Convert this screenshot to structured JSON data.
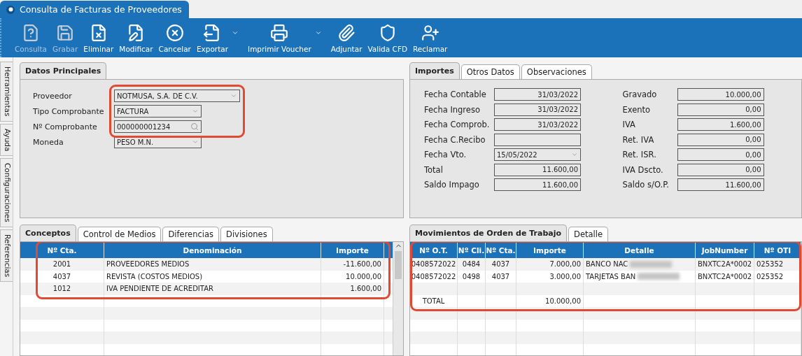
{
  "window": {
    "title": "Consulta de Facturas de Proveedores"
  },
  "toolbar": [
    {
      "label": "Consulta",
      "disabled": true,
      "dropdown": false
    },
    {
      "label": "Grabar",
      "disabled": true,
      "dropdown": false
    },
    {
      "label": "Eliminar",
      "disabled": false,
      "dropdown": false
    },
    {
      "label": "Modificar",
      "disabled": false,
      "dropdown": false
    },
    {
      "label": "Cancelar",
      "disabled": false,
      "dropdown": false
    },
    {
      "label": "Exportar",
      "disabled": false,
      "dropdown": true
    },
    {
      "label": "Imprimir Voucher",
      "disabled": false,
      "dropdown": true
    },
    {
      "label": "Adjuntar",
      "disabled": false,
      "dropdown": false
    },
    {
      "label": "Valida CFD",
      "disabled": false,
      "dropdown": false
    },
    {
      "label": "Reclamar",
      "disabled": false,
      "dropdown": false
    }
  ],
  "side_tabs": [
    {
      "label": "Herramientas"
    },
    {
      "label": "Ayuda"
    },
    {
      "label": "Configuraciones"
    },
    {
      "label": "Referencias"
    }
  ],
  "datos_principales": {
    "tabs": [
      {
        "label": "Datos Principales",
        "selected": true
      }
    ],
    "fields": [
      {
        "label": "Proveedor",
        "value": "NOTMUSA, S.A. DE C.V.",
        "kind": "select",
        "highlighted": true
      },
      {
        "label": "Tipo Comprobante",
        "value": "FACTURA",
        "kind": "select",
        "highlighted": true
      },
      {
        "label": "Nº Comprobante",
        "value": "000000001234",
        "kind": "search",
        "highlighted": true
      },
      {
        "label": "Moneda",
        "value": "PESO M.N.",
        "kind": "select",
        "highlighted": false
      }
    ]
  },
  "importes": {
    "tabs": [
      {
        "label": "Importes",
        "selected": true
      },
      {
        "label": "Otros Datos",
        "selected": false
      },
      {
        "label": "Observaciones",
        "selected": false
      }
    ],
    "left_fields": [
      {
        "label": "Fecha Contable",
        "value": "31/03/2022",
        "kind": "text"
      },
      {
        "label": "Fecha Ingreso",
        "value": "31/03/2022",
        "kind": "text"
      },
      {
        "label": "Fecha Comprob.",
        "value": "31/03/2022",
        "kind": "text"
      },
      {
        "label": "Fecha C.Recibo",
        "kind": "text"
      },
      {
        "label": "Fecha Vto.",
        "value": "15/05/2022",
        "kind": "select"
      },
      {
        "label": "Total",
        "value": "11.600,00",
        "kind": "text"
      },
      {
        "label": "Saldo Impago",
        "value": "11.600,00",
        "kind": "text"
      }
    ],
    "right_fields": [
      {
        "label": "Gravado",
        "value": "10.000,00",
        "kind": "text"
      },
      {
        "label": "Exento",
        "value": "0,00",
        "kind": "text"
      },
      {
        "label": "IVA",
        "value": "1.600,00",
        "kind": "text"
      },
      {
        "label": "Ret. IVA",
        "value": "0,00",
        "kind": "text"
      },
      {
        "label": "Ret. ISR.",
        "value": "0,00",
        "kind": "text"
      },
      {
        "label": "IVA Dscto.",
        "value": "0,00",
        "kind": "text"
      },
      {
        "label": "Saldo s/O.P.",
        "value": "11.600,00",
        "kind": "text"
      }
    ]
  },
  "conceptos": {
    "tabs": [
      {
        "label": "Conceptos",
        "selected": true
      },
      {
        "label": "Control de Medios",
        "selected": false
      },
      {
        "label": "Diferencias",
        "selected": false
      },
      {
        "label": "Divisiones",
        "selected": false
      }
    ],
    "highlighted": true,
    "columns": [
      "Nº Cta.",
      "Denominación",
      "Importe"
    ],
    "rows": [
      {
        "kind": "data",
        "cells": [
          "2001",
          "PROVEEDORES MEDIOS",
          "-11.600,00"
        ]
      },
      {
        "kind": "data",
        "cells": [
          "4037",
          "REVISTA (COSTOS MEDIOS)",
          "10.000,00"
        ]
      },
      {
        "kind": "data",
        "cells": [
          "1012",
          "IVA PENDIENTE DE ACREDITAR",
          "1.600,00"
        ]
      }
    ]
  },
  "movimientos": {
    "tabs": [
      {
        "label": "Movimientos de Orden de Trabajo",
        "selected": true
      },
      {
        "label": "Detalle",
        "selected": false
      }
    ],
    "highlighted": true,
    "columns": [
      "Nº O.T.",
      "Nº Cli.",
      "Nº Cta.",
      "Importe",
      "Detalle",
      "JobNumber",
      "Nº OTI"
    ],
    "rows": [
      {
        "kind": "data",
        "cells": [
          "0408572022",
          "0484",
          "4037",
          "7.000,00",
          "BANCO NAC",
          "BNXTC2A*0002",
          "025352"
        ],
        "blurred": true
      },
      {
        "kind": "data",
        "cells": [
          "0408572022",
          "0498",
          "4037",
          "3.000,00",
          "TARJETAS BAN",
          "BNXTC2A*0002",
          "025352"
        ],
        "blurred": true
      },
      {
        "kind": "blank"
      },
      {
        "kind": "total",
        "label": "TOTAL",
        "amount": "10.000,00"
      }
    ]
  }
}
